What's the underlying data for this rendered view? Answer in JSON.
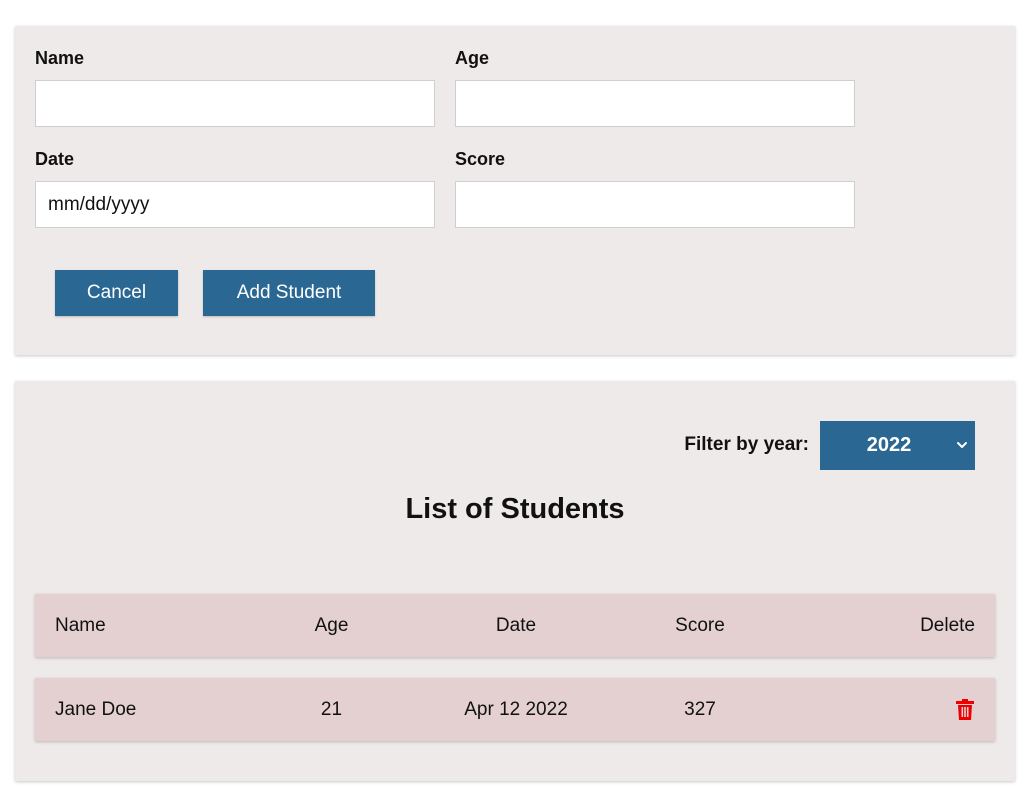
{
  "form": {
    "name_label": "Name",
    "age_label": "Age",
    "date_label": "Date",
    "score_label": "Score",
    "name_value": "",
    "age_value": "",
    "date_placeholder": "mm/dd/yyyy",
    "score_value": "",
    "cancel_label": "Cancel",
    "add_label": "Add Student"
  },
  "list": {
    "filter_label": "Filter by year:",
    "filter_value": "2022",
    "title": "List of Students",
    "headers": {
      "name": "Name",
      "age": "Age",
      "date": "Date",
      "score": "Score",
      "delete": "Delete"
    },
    "rows": [
      {
        "name": "Jane Doe",
        "age": "21",
        "date": "Apr 12 2022",
        "score": "327",
        "delete_icon": "trash-icon"
      }
    ]
  },
  "colors": {
    "card_bg": "#efeaea",
    "button_bg": "#2a6792",
    "row_bg": "#e4d0d1",
    "delete_icon": "#ee0000"
  }
}
